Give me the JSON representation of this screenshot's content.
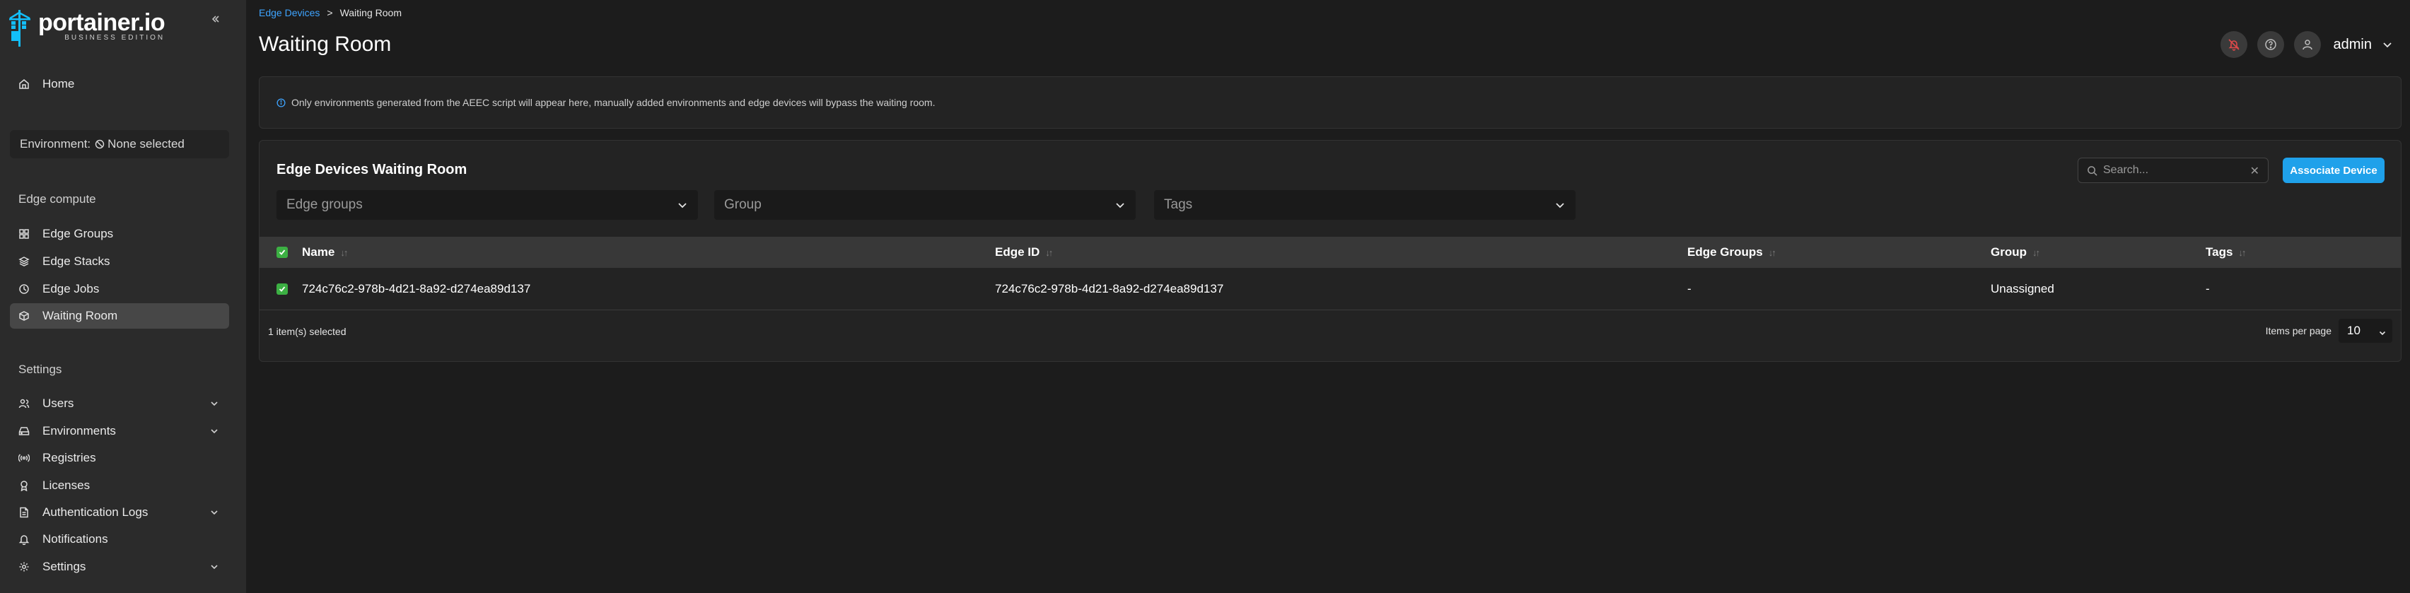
{
  "logo": {
    "name": "portainer.io",
    "edition": "BUSINESS EDITION"
  },
  "sidebar": {
    "home": "Home",
    "environment_label": "Environment:",
    "environment_value": "None selected",
    "edge_section": "Edge compute",
    "edge_items": [
      {
        "label": "Edge Groups",
        "icon": "grid-icon"
      },
      {
        "label": "Edge Stacks",
        "icon": "layers-icon"
      },
      {
        "label": "Edge Jobs",
        "icon": "clock-icon"
      },
      {
        "label": "Waiting Room",
        "icon": "box-icon",
        "active": true
      }
    ],
    "settings_section": "Settings",
    "settings_items": [
      {
        "label": "Users",
        "icon": "users-icon",
        "expandable": true
      },
      {
        "label": "Environments",
        "icon": "hard-drive-icon",
        "expandable": true
      },
      {
        "label": "Registries",
        "icon": "radio-icon"
      },
      {
        "label": "Licenses",
        "icon": "award-icon"
      },
      {
        "label": "Authentication Logs",
        "icon": "file-text-icon",
        "expandable": true
      },
      {
        "label": "Notifications",
        "icon": "bell-icon"
      },
      {
        "label": "Settings",
        "icon": "settings-icon",
        "expandable": true
      }
    ]
  },
  "breadcrumb": {
    "parent": "Edge Devices",
    "separator": ">",
    "current": "Waiting Room"
  },
  "header": {
    "title": "Waiting Room",
    "user": "admin"
  },
  "info": {
    "text": "Only environments generated from the AEEC script will appear here, manually added environments and edge devices will bypass the waiting room."
  },
  "panel": {
    "title": "Edge Devices Waiting Room",
    "search_placeholder": "Search...",
    "associate_label": "Associate Device",
    "filters": [
      "Edge groups",
      "Group",
      "Tags"
    ]
  },
  "table": {
    "columns": [
      "Name",
      "Edge ID",
      "Edge Groups",
      "Group",
      "Tags"
    ],
    "rows": [
      {
        "name": "724c76c2-978b-4d21-8a92-d274ea89d137",
        "edge_id": "724c76c2-978b-4d21-8a92-d274ea89d137",
        "edge_groups": "-",
        "group": "Unassigned",
        "tags": "-",
        "selected": true
      }
    ],
    "selected_text": "1 item(s) selected",
    "per_page_label": "Items per page",
    "per_page_value": "10"
  },
  "colors": {
    "accent": "#1fa1ea",
    "link": "#3ea4ff",
    "checkbox": "#3cb043",
    "active_nav": "#474747"
  }
}
